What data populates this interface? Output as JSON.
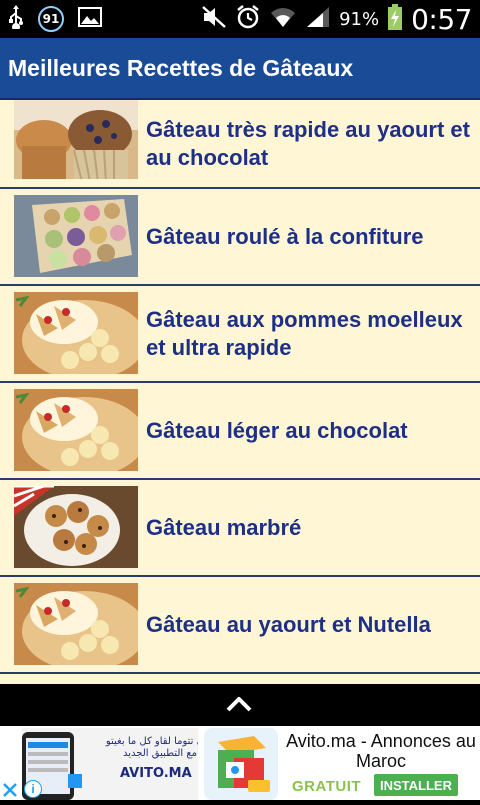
{
  "status_bar": {
    "notification_count": "91",
    "battery_percent": "91%",
    "time": "0:57",
    "icons": [
      "usb-icon",
      "image-icon",
      "mute-icon",
      "alarm-icon",
      "wifi-icon",
      "signal-icon",
      "battery-icon"
    ]
  },
  "app_bar": {
    "title": "Meilleures Recettes de Gâteaux"
  },
  "recipes": [
    {
      "label": "Gâteau très rapide au yaourt et au chocolat",
      "image": "muffins-photo"
    },
    {
      "label": "Gâteau roulé à la confiture",
      "image": "macarons-box-photo"
    },
    {
      "label": "Gâteau aux pommes moelleux et ultra rapide",
      "image": "banana-crepes-photo"
    },
    {
      "label": "Gâteau léger au chocolat",
      "image": "banana-crepes-photo"
    },
    {
      "label": "Gâteau marbré",
      "image": "cookies-photo"
    },
    {
      "label": "Gâteau au yaourt et Nutella",
      "image": "banana-crepes-photo"
    }
  ],
  "ad": {
    "arabic_line": "حتى تتوما لقاو كل ما بغيتو مع التطبيق الجديد",
    "brand_small": "AVITO.MA",
    "title": "Avito.ma - Annonces au Maroc",
    "price": "GRATUIT",
    "install_label": "INSTALLER",
    "info_label": "i"
  },
  "colors": {
    "app_bar": "#1a4b97",
    "list_bg": "#fff6d6",
    "label": "#1e2f86",
    "divider": "#2a3b6e",
    "install": "#4caf50"
  }
}
